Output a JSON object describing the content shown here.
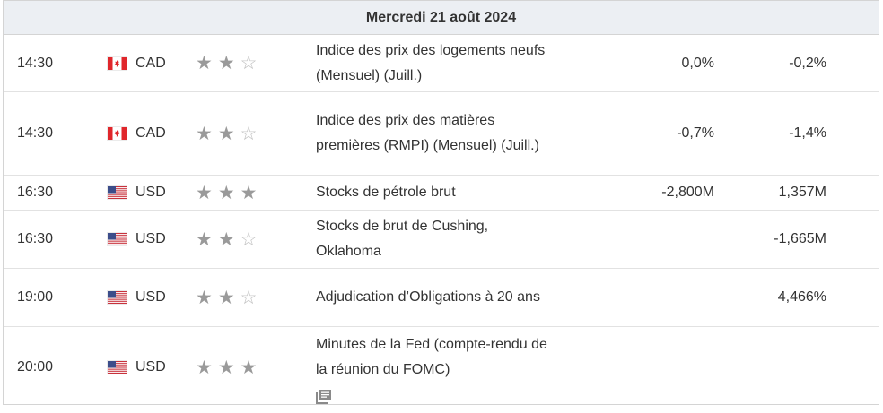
{
  "header": {
    "date": "Mercredi 21 août 2024"
  },
  "colors": {
    "header_bg": "#eceff3",
    "border": "#d4d4d4",
    "star_active": "#9a9a9a",
    "star_inactive": "#bcbcbc",
    "text": "#333333"
  },
  "events": [
    {
      "time": "14:30",
      "currency": "CAD",
      "flag": "canada-flag-icon",
      "importance": 2,
      "event": "Indice des prix des logements neufs (Mensuel) (Juill.)",
      "actual": "0,0%",
      "previous": "-0,2%"
    },
    {
      "time": "14:30",
      "currency": "CAD",
      "flag": "canada-flag-icon",
      "importance": 2,
      "event": "Indice des prix des matières premières (RMPI) (Mensuel) (Juill.)",
      "actual": "-0,7%",
      "previous": "-1,4%"
    },
    {
      "time": "16:30",
      "currency": "USD",
      "flag": "usa-flag-icon",
      "importance": 3,
      "event": "Stocks de pétrole brut",
      "actual": "-2,800M",
      "previous": "1,357M"
    },
    {
      "time": "16:30",
      "currency": "USD",
      "flag": "usa-flag-icon",
      "importance": 2,
      "event": "Stocks de brut de Cushing, Oklahoma",
      "actual": "",
      "previous": "-1,665M"
    },
    {
      "time": "19:00",
      "currency": "USD",
      "flag": "usa-flag-icon",
      "importance": 2,
      "event": "Adjudication d’Obligations à 20 ans",
      "actual": "",
      "previous": "4,466%"
    },
    {
      "time": "20:00",
      "currency": "USD",
      "flag": "usa-flag-icon",
      "importance": 3,
      "event": "Minutes de la Fed (compte-rendu de la réunion du FOMC)",
      "actual": "",
      "previous": "",
      "has_report_icon": true
    }
  ]
}
